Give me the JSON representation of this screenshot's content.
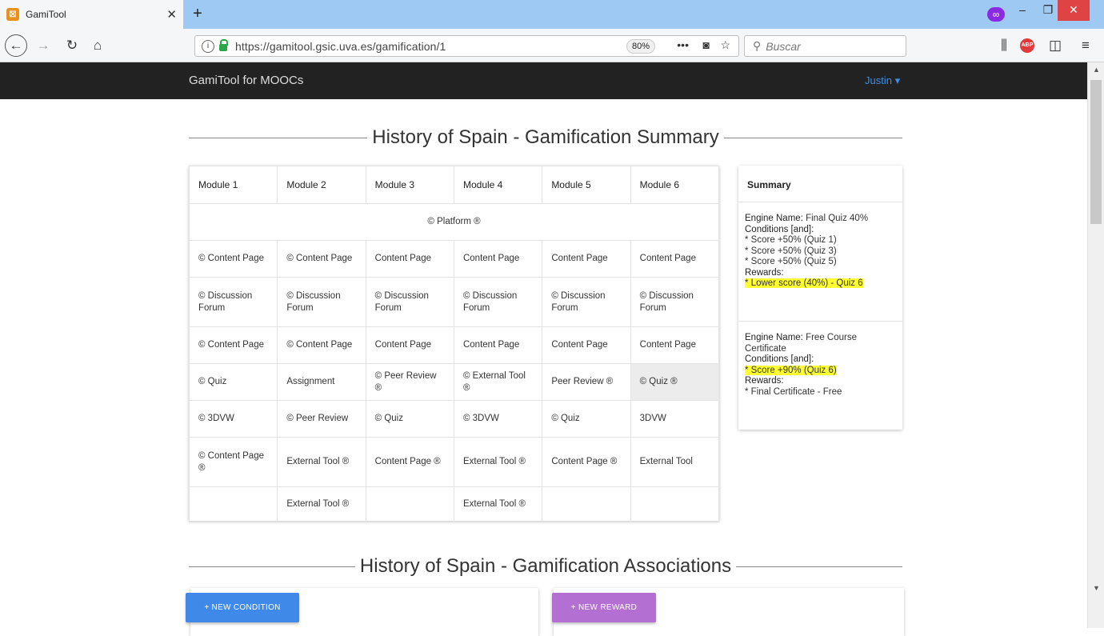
{
  "browser": {
    "tab_title": "GamiTool",
    "tab_favicon": "gamitool-icon",
    "url": "https://gamitool.gsic.uva.es/gamification/1",
    "zoom": "80%",
    "search_placeholder": "Buscar"
  },
  "app": {
    "brand": "GamiTool for MOOCs",
    "user": "Justin ▾"
  },
  "summary_title": "History of Spain - Gamification Summary",
  "grid": {
    "headers": [
      "Module 1",
      "Module 2",
      "Module 3",
      "Module 4",
      "Module 5",
      "Module 6"
    ],
    "platform": "© Platform ®",
    "rows": [
      [
        "© Content Page",
        "© Content Page",
        "Content Page",
        "Content Page",
        "Content Page",
        "Content Page"
      ],
      [
        "© Discussion Forum",
        "© Discussion Forum",
        "© Discussion Forum",
        "© Discussion Forum",
        "© Discussion Forum",
        "© Discussion Forum"
      ],
      [
        "© Content Page",
        "© Content Page",
        "Content Page",
        "Content Page",
        "Content Page",
        "Content Page"
      ],
      [
        "© Quiz",
        "Assignment",
        "© Peer Review ®",
        "© External Tool ®",
        "Peer Review ®",
        "© Quiz ®"
      ],
      [
        "© 3DVW",
        "© Peer Review",
        "© Quiz",
        "© 3DVW",
        "© Quiz",
        "3DVW"
      ],
      [
        "© Content Page ®",
        "External Tool ®",
        "Content Page ®",
        "External Tool ®",
        "Content Page ®",
        "External Tool"
      ],
      [
        "",
        "External Tool ®",
        "",
        "External Tool ®",
        "",
        ""
      ]
    ]
  },
  "summary": {
    "title": "Summary",
    "engines": [
      {
        "name_label": "Engine Name:",
        "name": "Final Quiz 40%",
        "conditions_label": "Conditions [and]:",
        "conditions": [
          "* Score +50% (Quiz 1)",
          "* Score +50% (Quiz 3)",
          "* Score +50% (Quiz 5)"
        ],
        "rewards_label": "Rewards:",
        "rewards": [
          "* Lower score (40%) - Quiz 6"
        ]
      },
      {
        "name_label": "Engine Name:",
        "name": "Free Course Certificate",
        "conditions_label": "Conditions [and]:",
        "conditions": [
          "* Score +90% (Quiz 6)"
        ],
        "rewards_label": "Rewards:",
        "rewards": [
          "* Final Certificate - Free"
        ]
      }
    ]
  },
  "associations_title": "History of Spain - Gamification Associations",
  "buttons": {
    "new_condition": "+ NEW CONDITION",
    "new_reward": "+ NEW REWARD"
  },
  "colors": {
    "condition_button": "#3f8ae8",
    "reward_button": "#b46fd3",
    "highlight": "#ffff33",
    "appbar": "#222222"
  }
}
